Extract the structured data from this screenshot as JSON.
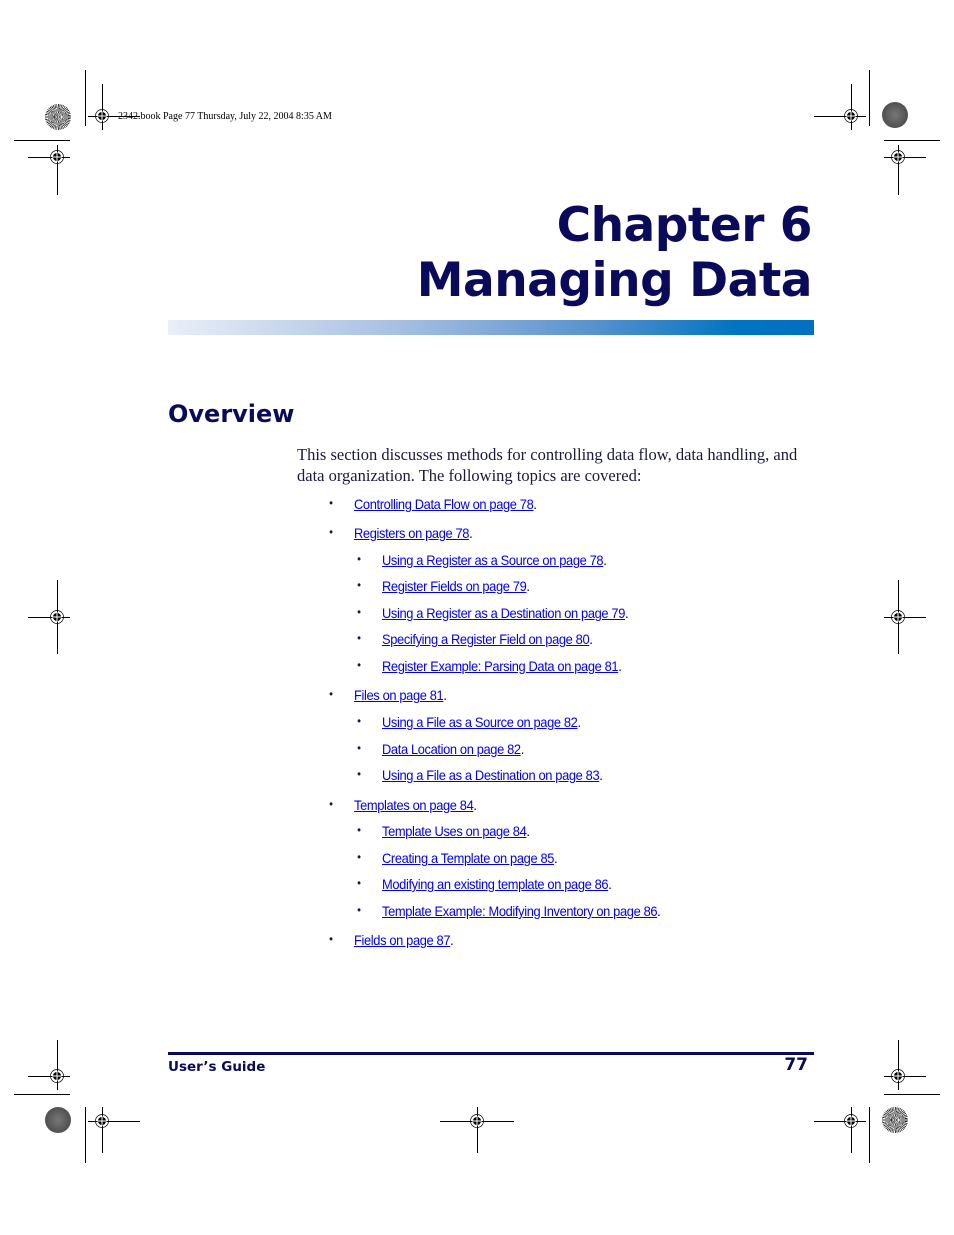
{
  "slug": "2342.book  Page 77  Thursday, July 22, 2004  8:35 AM",
  "chapter": {
    "line1": "Chapter 6",
    "line2": "Managing Data"
  },
  "section": {
    "title": "Overview",
    "intro": "This section discusses methods for controlling data flow, data handling, and data organization. The following topics are covered:"
  },
  "topics": [
    {
      "level": 1,
      "link": "Controlling Data Flow on page 78",
      "suffix": "."
    },
    {
      "level": 1,
      "link": "Registers on page 78",
      "suffix": "."
    },
    {
      "level": 2,
      "link": "Using a Register as a Source on page 78",
      "suffix": "."
    },
    {
      "level": 2,
      "link": "Register Fields on page 79",
      "suffix": "."
    },
    {
      "level": 2,
      "link": "Using a Register as a Destination on page 79",
      "suffix": "."
    },
    {
      "level": 2,
      "link": "Specifying a Register Field on page 80",
      "suffix": "."
    },
    {
      "level": 2,
      "link": "Register Example: Parsing Data on page 81",
      "suffix": "."
    },
    {
      "level": 1,
      "link": "Files on page 81",
      "suffix": "."
    },
    {
      "level": 2,
      "link": "Using a File as a Source on page 82",
      "suffix": "."
    },
    {
      "level": 2,
      "link": "Data Location on page 82",
      "suffix": "."
    },
    {
      "level": 2,
      "link": "Using a File as a Destination on page 83",
      "suffix": "."
    },
    {
      "level": 1,
      "link": "Templates on page 84",
      "suffix": "."
    },
    {
      "level": 2,
      "link": "Template Uses on page 84",
      "suffix": "."
    },
    {
      "level": 2,
      "link": "Creating a Template on page 85",
      "suffix": "."
    },
    {
      "level": 2,
      "link": "Modifying an existing template on page 86",
      "suffix": "."
    },
    {
      "level": 2,
      "link": "Template Example: Modifying Inventory on page 86",
      "suffix": "."
    },
    {
      "level": 1,
      "link": "Fields on page 87",
      "suffix": "."
    }
  ],
  "bullet_glyph": "•",
  "footer": {
    "left": "User’s Guide",
    "page_number": "77"
  },
  "colors": {
    "heading": "#0a0a5a",
    "link": "#0000ee",
    "bar_start": "#eaeff8",
    "bar_end": "#0070c0"
  }
}
